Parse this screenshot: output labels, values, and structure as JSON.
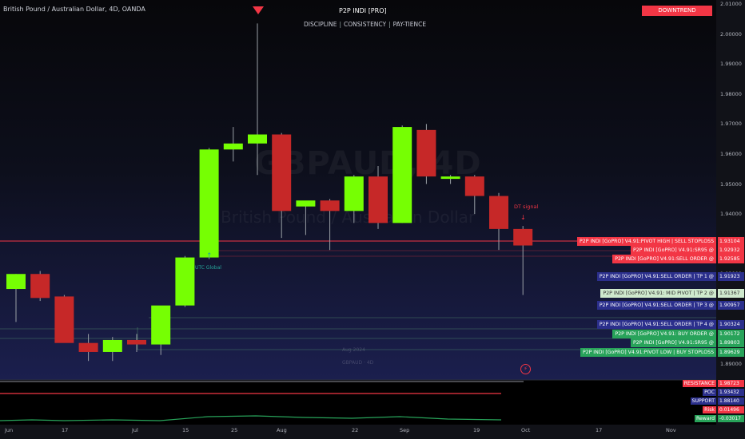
{
  "header": {
    "symbol_line": "British Pound / Australian Dollar, 4D, OANDA",
    "indicator_title": "P2P INDI [PRO]",
    "tagline": [
      "DISCIPLINE",
      "CONSISTENCY",
      "PAY-TIENCE"
    ],
    "tagline_sep": "|",
    "trend_badge": "DOWNTREND"
  },
  "watermark": {
    "symbol": "GBPAUD, 4D",
    "name": "British Pound / Australian Dollar"
  },
  "pane_watermark": {
    "date": "Aug 2024",
    "symbol": "GBPAUD · 4D"
  },
  "signals": {
    "dt_signal": "DT signal",
    "up_label": "UTC Global"
  },
  "price_axis": [
    "2.01000",
    "2.00000",
    "1.99000",
    "1.98000",
    "1.97000",
    "1.96000",
    "1.95000",
    "1.94000",
    "1.93000",
    "1.92000",
    "1.91000",
    "1.90000",
    "1.89000"
  ],
  "time_axis": [
    "Jun",
    "17",
    "Jul",
    "15",
    "25",
    "Aug",
    "22",
    "Sep",
    "19",
    "Oct",
    "17",
    "Nov"
  ],
  "levels": [
    {
      "label": "P2P INDI [GoPRO] V4.91:PIVOT HIGH | SELL STOPLOSS",
      "price": "1.93104",
      "style": "red"
    },
    {
      "label": "P2P INDI [GoPRO] V4.91:SR95 @",
      "price": "1.92932",
      "style": "red"
    },
    {
      "label": "P2P INDI [GoPRO] V4.91:SELL ORDER @",
      "price": "1.92585",
      "style": "red"
    },
    {
      "label": "P2P INDI [GoPRO] V4.91:SELL ORDER | TP 1 @",
      "price": "1.91923",
      "style": "navy"
    },
    {
      "label": "P2P INDI [GoPRO] V4.91: MID PIVOT | TP 2 @",
      "price": "1.91367",
      "style": "light"
    },
    {
      "label": "P2P INDI [GoPRO] V4.91:SELL ORDER | TP 3 @",
      "price": "1.90957",
      "style": "navy"
    },
    {
      "label": "P2P INDI [GoPRO] V4.91:SELL ORDER | TP 4 @",
      "price": "1.90324",
      "style": "navy"
    },
    {
      "label": "P2P INDI [GoPRO] V4.91: BUY ORDER @",
      "price": "1.90172",
      "style": "green"
    },
    {
      "label": "P2P INDI [GoPRO] V4.91:SR95 @",
      "price": "1.89803",
      "style": "green"
    },
    {
      "label": "P2P INDI [GoPRO] V4.91:PIVOT LOW | BUY STOPLOSS",
      "price": "1.89629",
      "style": "green"
    }
  ],
  "indicators": [
    {
      "label": "RESISTANCE",
      "value": "1.98723",
      "color": "#f23645"
    },
    {
      "label": "POC",
      "value": "1.93432",
      "color": "#2b2f8c"
    },
    {
      "label": "SUPPORT",
      "value": "1.88140",
      "color": "#2b2f8c"
    },
    {
      "label": "Risk",
      "value": "0.01496",
      "color": "#f23645"
    },
    {
      "label": "Reward",
      "value": "-0.03017",
      "color": "#28a35a"
    }
  ],
  "chart_data": {
    "type": "candlestick",
    "title": "British Pound / Australian Dollar, 4D, OANDA",
    "ylim": [
      1.885,
      2.011
    ],
    "candles": [
      {
        "o": 1.915,
        "h": 1.92,
        "l": 1.904,
        "c": 1.92,
        "color": "green"
      },
      {
        "o": 1.92,
        "h": 1.921,
        "l": 1.911,
        "c": 1.912,
        "color": "red"
      },
      {
        "o": 1.9125,
        "h": 1.913,
        "l": 1.899,
        "c": 1.897,
        "color": "red"
      },
      {
        "o": 1.897,
        "h": 1.9,
        "l": 1.891,
        "c": 1.894,
        "color": "red"
      },
      {
        "o": 1.894,
        "h": 1.899,
        "l": 1.891,
        "c": 1.898,
        "color": "green"
      },
      {
        "o": 1.898,
        "h": 1.9,
        "l": 1.894,
        "c": 1.8965,
        "color": "red"
      },
      {
        "o": 1.8965,
        "h": 1.908,
        "l": 1.893,
        "c": 1.9095,
        "color": "green"
      },
      {
        "o": 1.9095,
        "h": 1.926,
        "l": 1.909,
        "c": 1.9255,
        "color": "green"
      },
      {
        "o": 1.9255,
        "h": 1.962,
        "l": 1.925,
        "c": 1.9615,
        "color": "green"
      },
      {
        "o": 1.9615,
        "h": 1.969,
        "l": 1.9575,
        "c": 1.9635,
        "color": "green"
      },
      {
        "o": 1.9635,
        "h": 2.0035,
        "l": 1.953,
        "c": 1.9665,
        "color": "green"
      },
      {
        "o": 1.9665,
        "h": 1.967,
        "l": 1.932,
        "c": 1.941,
        "color": "red"
      },
      {
        "o": 1.9425,
        "h": 1.944,
        "l": 1.933,
        "c": 1.9445,
        "color": "green"
      },
      {
        "o": 1.9445,
        "h": 1.945,
        "l": 1.928,
        "c": 1.941,
        "color": "red"
      },
      {
        "o": 1.941,
        "h": 1.953,
        "l": 1.937,
        "c": 1.9525,
        "color": "green"
      },
      {
        "o": 1.9525,
        "h": 1.956,
        "l": 1.935,
        "c": 1.937,
        "color": "red"
      },
      {
        "o": 1.937,
        "h": 1.9695,
        "l": 1.937,
        "c": 1.969,
        "color": "green"
      },
      {
        "o": 1.968,
        "h": 1.97,
        "l": 1.95,
        "c": 1.9525,
        "color": "red"
      },
      {
        "o": 1.9525,
        "h": 1.953,
        "l": 1.95,
        "c": 1.952,
        "color": "green"
      },
      {
        "o": 1.9525,
        "h": 1.953,
        "l": 1.94,
        "c": 1.946,
        "color": "red"
      },
      {
        "o": 1.946,
        "h": 1.947,
        "l": 1.928,
        "c": 1.935,
        "color": "red"
      },
      {
        "o": 1.935,
        "h": 1.936,
        "l": 1.913,
        "c": 1.9295,
        "color": "red"
      }
    ]
  }
}
